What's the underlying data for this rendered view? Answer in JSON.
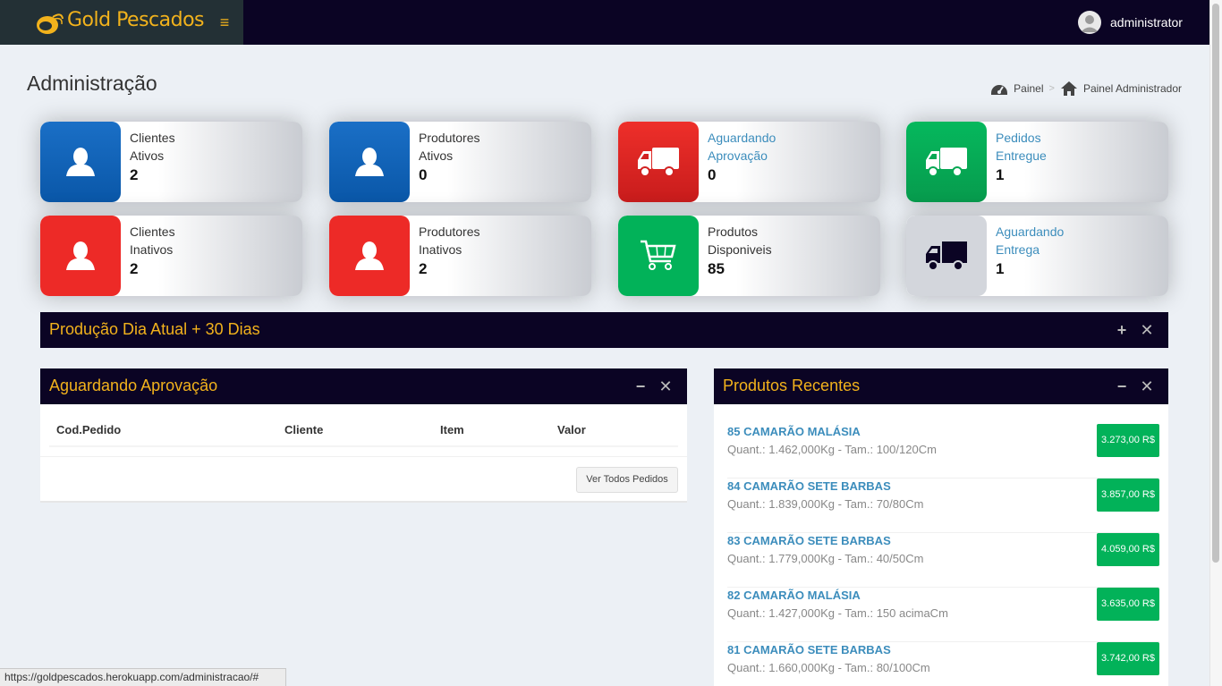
{
  "header": {
    "logo_text": "Gold Pescados",
    "user_name": "administrator"
  },
  "page": {
    "title": "Administração",
    "breadcrumb": {
      "item1": "Painel",
      "item2": "Painel Administrador"
    }
  },
  "info_boxes": [
    {
      "line1": "Clientes",
      "line2": "Ativos",
      "number": "2",
      "icon": "user-icon",
      "color": "#0a5eb0"
    },
    {
      "line1": "Produtores",
      "line2": "Ativos",
      "number": "0",
      "icon": "user-icon",
      "color": "#0a5eb0"
    },
    {
      "line1": "Aguardando",
      "line2": "Aprovação",
      "number": "0",
      "icon": "truck-icon",
      "color": "#dd2222"
    },
    {
      "line1": "Pedidos",
      "line2": "Entregue",
      "number": "1",
      "icon": "truck-icon",
      "color": "#06a853"
    },
    {
      "line1": "Clientes",
      "line2": "Inativos",
      "number": "2",
      "icon": "user-icon",
      "color": "#ed2a27"
    },
    {
      "line1": "Produtores",
      "line2": "Inativos",
      "number": "2",
      "icon": "user-icon",
      "color": "#ed2a27"
    },
    {
      "line1": "Produtos",
      "line2": "Disponiveis",
      "number": "85",
      "icon": "cart-icon",
      "color": "#02b259"
    },
    {
      "line1": "Aguardando",
      "line2": "Entrega",
      "number": "1",
      "icon": "truck-icon",
      "color": "#d3d6dc"
    }
  ],
  "production_box": {
    "title": "Produção Dia Atual + 30 Dias"
  },
  "approval_box": {
    "title": "Aguardando Aprovação",
    "columns": [
      "Cod.Pedido",
      "Cliente",
      "Item",
      "Valor"
    ],
    "button": "Ver Todos Pedidos"
  },
  "recent_products": {
    "title": "Produtos Recentes",
    "items": [
      {
        "name": "85 CAMARÃO MALÁSIA",
        "desc": "Quant.: 1.462,000Kg - Tam.: 100/120Cm",
        "price": "3.273,00 R$"
      },
      {
        "name": "84 CAMARÃO SETE BARBAS",
        "desc": "Quant.: 1.839,000Kg - Tam.: 70/80Cm",
        "price": "3.857,00 R$"
      },
      {
        "name": "83 CAMARÃO SETE BARBAS",
        "desc": "Quant.: 1.779,000Kg - Tam.: 40/50Cm",
        "price": "4.059,00 R$"
      },
      {
        "name": "82 CAMARÃO MALÁSIA",
        "desc": "Quant.: 1.427,000Kg - Tam.: 150 acimaCm",
        "price": "3.635,00 R$"
      },
      {
        "name": "81 CAMARÃO SETE BARBAS",
        "desc": "Quant.: 1.660,000Kg - Tam.: 80/100Cm",
        "price": "3.742,00 R$"
      }
    ]
  },
  "status_bar": {
    "url": "https://goldpescados.herokuapp.com/administracao/#"
  }
}
